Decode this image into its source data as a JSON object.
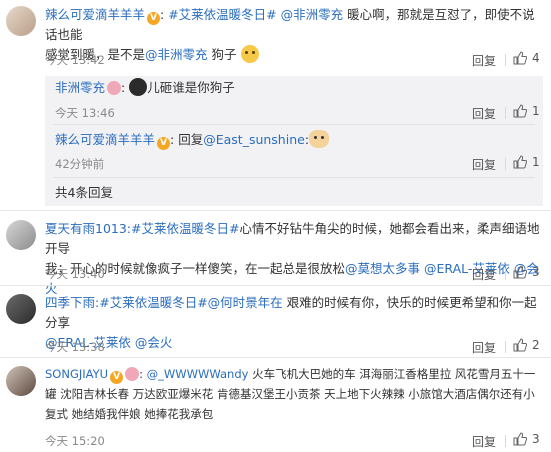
{
  "colors": {
    "link": "#2a6dbd",
    "time": "#8a8a8a",
    "badge": "#f5a623"
  },
  "comments": [
    {
      "user": "辣么可爱滴羊羊羊",
      "topic": "#艾莱依温暖冬日#",
      "mention": "@非洲零充",
      "text1": "暖心啊，那就是互怼了，即使不说话也能",
      "text2a": "感觉到暖，是不是",
      "mention2": "@非洲零充",
      "text2b": "狗子",
      "time": "今天 13:42",
      "reply": "回复",
      "likes": "4"
    },
    {
      "user": "夏天有雨1013:",
      "topic": "#艾莱依温暖冬日#",
      "text1": "心情不好钻牛角尖的时候，她都会看出来，柔声细语地开导",
      "text2a": "我；开心的时候就像疯子一样傻笑，在一起总是很放松",
      "mention2": "@莫想太多事 @ERAL-艾莱依 @会火",
      "time": "今天 13:40",
      "reply": "回复",
      "likes": "3"
    },
    {
      "user": "四季下雨:",
      "topic": "#艾莱依温暖冬日#",
      "mention": "@何时景年在",
      "text1": "艰难的时候有你，快乐的时候更希望和你一起分享",
      "mention2": "@ERAL-艾莱依 @会火",
      "time": "今天 13:38",
      "reply": "回复",
      "likes": "2"
    },
    {
      "user": "SONGJIAYU",
      "mention": "@_WWWWWandy",
      "text1": "火车飞机大巴她的车 洱海丽江香格里拉 风花雪月五十一",
      "text2a": "罐 沈阳吉林长春 万达欧亚爆米花 肯德基汉堡王小贡茶 天上地下火辣辣 小旅馆大酒店偶尔还有小",
      "text3": "复式 她结婚我伴娘 她捧花我承包",
      "time": "今天 15:20",
      "reply": "回复",
      "likes": "3"
    }
  ],
  "subreplies": [
    {
      "user": "非洲零充",
      "text": "儿砸谁是你狗子",
      "time": "今天 13:46",
      "reply": "回复",
      "likes": "1"
    },
    {
      "user": "辣么可爱滴羊羊羊",
      "prefix": "回复",
      "mention": "@East_sunshine",
      "colon": ":",
      "time": "42分钟前",
      "reply": "回复",
      "likes": "1"
    }
  ],
  "more_replies": "共4条回复",
  "icons": [
    "thumb-up-icon",
    "verified-badge-icon",
    "vip-icon",
    "emoji-icon"
  ]
}
